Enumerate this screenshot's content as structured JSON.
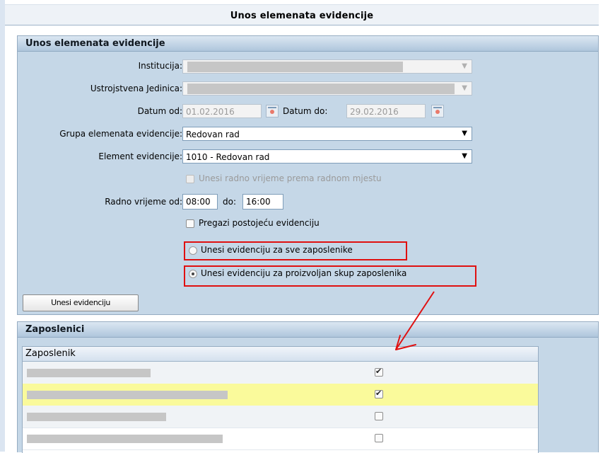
{
  "page_title": "Unos elemenata evidencije",
  "form": {
    "header": "Unos elemenata evidencije",
    "institucija_label": "Institucija:",
    "ustrojstvena_label": "Ustrojstvena Jedinica:",
    "datum_od_label": "Datum od:",
    "datum_od_value": "01.02.2016",
    "datum_do_label": "Datum do:",
    "datum_do_value": "29.02.2016",
    "grupa_label": "Grupa elemenata evidencije:",
    "grupa_value": "Redovan rad",
    "element_label": "Element evidencije:",
    "element_value": "1010 - Redovan rad",
    "radno_mjesto_label": "Unesi radno vrijeme prema radnom mjestu",
    "radno_od_label": "Radno vrijeme od:",
    "radno_od_value": "08:00",
    "radno_do_label": "do:",
    "radno_do_value": "16:00",
    "pregazi_label": "Pregazi postojeću evidenciju",
    "radio_all_label": "Unesi evidenciju za sve zaposlenike",
    "radio_custom_label": "Unesi evidenciju za proizvoljan skup zaposlenika",
    "submit_label": "Unesi evidenciju"
  },
  "employees": {
    "header": "Zaposlenici",
    "column_header": "Zaposlenik",
    "rows": [
      {
        "name_width": 0.24,
        "checked": true,
        "highlighted": false
      },
      {
        "name_width": 0.39,
        "checked": true,
        "highlighted": true
      },
      {
        "name_width": 0.27,
        "checked": false,
        "highlighted": false
      },
      {
        "name_width": 0.38,
        "checked": false,
        "highlighted": false
      }
    ]
  },
  "colors": {
    "panel_bg": "#c5d7e7",
    "highlight_row": "#fafa9b",
    "annotation_red": "#e01010"
  }
}
